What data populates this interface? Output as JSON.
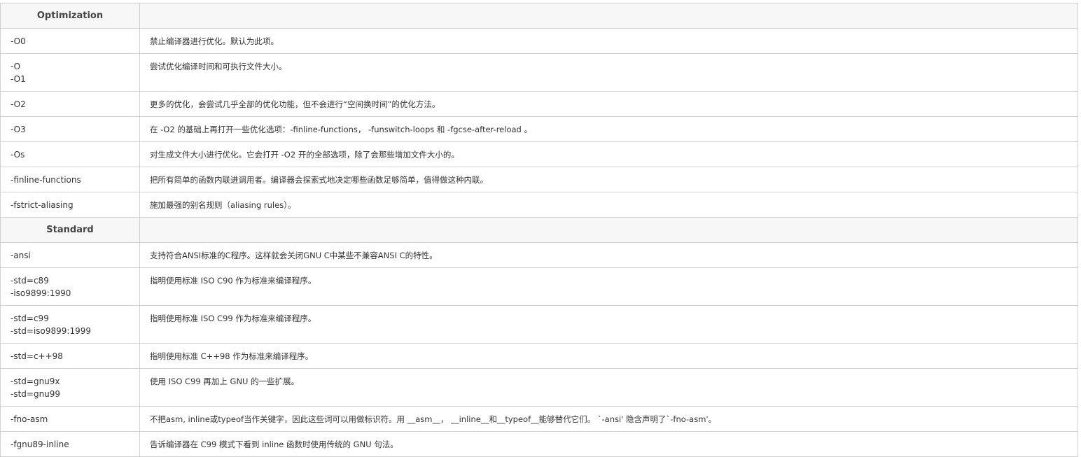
{
  "sections": {
    "optimization": {
      "title": "Optimization",
      "rows": [
        {
          "options": [
            "-O0"
          ],
          "description": "禁止编译器进行优化。默认为此项。"
        },
        {
          "options": [
            "-O",
            "-O1"
          ],
          "description": "尝试优化编译时间和可执行文件大小。"
        },
        {
          "options": [
            "-O2"
          ],
          "description": "更多的优化，会尝试几乎全部的优化功能，但不会进行“空间换时间”的优化方法。"
        },
        {
          "options": [
            "-O3"
          ],
          "description": "在 -O2 的基础上再打开一些优化选项：-finline-functions， -funswitch-loops 和 -fgcse-after-reload 。"
        },
        {
          "options": [
            "-Os"
          ],
          "description": "对生成文件大小进行优化。它会打开 -O2 开的全部选项，除了会那些增加文件大小的。"
        },
        {
          "options": [
            "-finline-functions"
          ],
          "description": "把所有简单的函数内联进调用者。编译器会探索式地决定哪些函数足够简单，值得做这种内联。"
        },
        {
          "options": [
            "-fstrict-aliasing"
          ],
          "description": "施加最强的别名规则（aliasing rules）。"
        }
      ]
    },
    "standard": {
      "title": "Standard",
      "rows": [
        {
          "options": [
            "-ansi"
          ],
          "description": "支持符合ANSI标准的C程序。这样就会关闭GNU C中某些不兼容ANSI C的特性。"
        },
        {
          "options": [
            "-std=c89",
            "-iso9899:1990"
          ],
          "description": "指明使用标准 ISO C90 作为标准来编译程序。"
        },
        {
          "options": [
            "-std=c99",
            "-std=iso9899:1999"
          ],
          "description": "指明使用标准 ISO C99 作为标准来编译程序。"
        },
        {
          "options": [
            "-std=c++98"
          ],
          "description": "指明使用标准 C++98 作为标准来编译程序。"
        },
        {
          "options": [
            "-std=gnu9x",
            "-std=gnu99"
          ],
          "description": "使用 ISO C99 再加上 GNU 的一些扩展。"
        },
        {
          "options": [
            "-fno-asm"
          ],
          "description": "不把asm, inline或typeof当作关键字，因此这些词可以用做标识符。用 __asm__， __inline__和__typeof__能够替代它们。 `-ansi' 隐含声明了`-fno-asm'。"
        },
        {
          "options": [
            "-fgnu89-inline"
          ],
          "description": "告诉编译器在 C99 模式下看到 inline 函数时使用传统的 GNU 句法。"
        }
      ]
    }
  }
}
